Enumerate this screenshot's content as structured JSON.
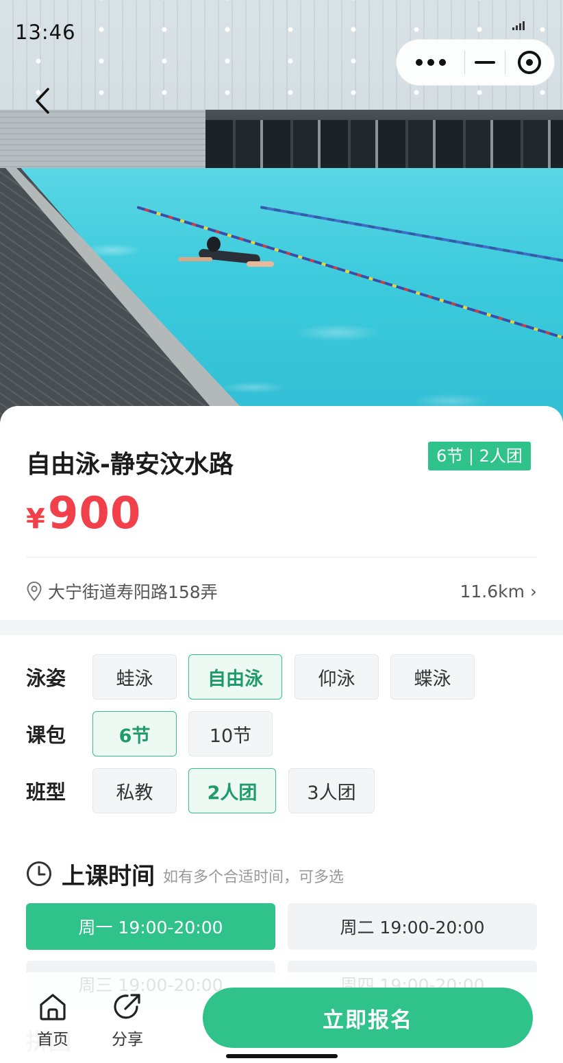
{
  "status_bar": {
    "time": "13:46"
  },
  "course": {
    "title": "自由泳-静安汶水路",
    "tag": "6节 | 2人团",
    "currency": "¥",
    "price": "900",
    "address": "大宁街道寿阳路158弄",
    "distance": "11.6km",
    "distance_arrow": "›"
  },
  "options": {
    "stroke": {
      "label": "泳姿",
      "items": [
        "蛙泳",
        "自由泳",
        "仰泳",
        "蝶泳"
      ],
      "selected": "自由泳"
    },
    "package": {
      "label": "课包",
      "items": [
        "6节",
        "10节"
      ],
      "selected": "6节"
    },
    "class_type": {
      "label": "班型",
      "items": [
        "私教",
        "2人团",
        "3人团"
      ],
      "selected": "2人团"
    }
  },
  "schedule": {
    "title": "上课时间",
    "hint": "如有多个合适时间，可多选",
    "slots": [
      "周一 19:00-20:00",
      "周二 19:00-20:00",
      "周三 19:00-20:00",
      "周四 19:00-20:00"
    ],
    "selected": "周一 19:00-20:00",
    "next_section_partial": "拼团"
  },
  "bottom_nav": {
    "home": "首页",
    "share": "分享",
    "cta": "立即报名"
  },
  "colors": {
    "accent_green": "#30c28b",
    "price_red": "#f2404a"
  },
  "icons": [
    "back-chevron-icon",
    "more-icon",
    "minimize-icon",
    "close-target-icon",
    "location-pin-icon",
    "clock-icon",
    "home-icon",
    "share-icon"
  ]
}
